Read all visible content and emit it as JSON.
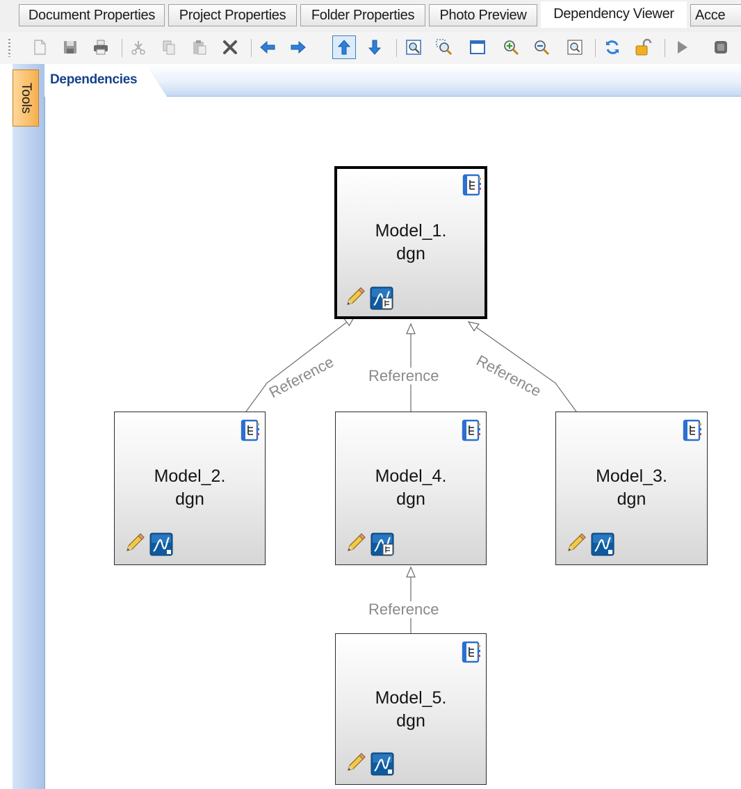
{
  "tabs": [
    {
      "label": "Document Properties"
    },
    {
      "label": "Project Properties"
    },
    {
      "label": "Folder Properties"
    },
    {
      "label": "Photo Preview"
    },
    {
      "label": "Dependency Viewer"
    },
    {
      "label": "Acce"
    }
  ],
  "active_tab": "Dependency Viewer",
  "toolbar": {
    "buttons": [
      {
        "icon": "new-document-icon"
      },
      {
        "icon": "save-icon"
      },
      {
        "icon": "print-icon"
      },
      {
        "icon": "cut-icon"
      },
      {
        "icon": "copy-icon"
      },
      {
        "icon": "paste-icon"
      },
      {
        "icon": "delete-icon"
      },
      {
        "icon": "arrow-left-icon"
      },
      {
        "icon": "arrow-right-icon"
      },
      {
        "icon": "arrow-up-icon",
        "pressed": true
      },
      {
        "icon": "arrow-down-icon"
      },
      {
        "icon": "fit-view-icon"
      },
      {
        "icon": "zoom-area-icon"
      },
      {
        "icon": "window-icon"
      },
      {
        "icon": "zoom-in-icon"
      },
      {
        "icon": "zoom-out-icon"
      },
      {
        "icon": "zoom-fit-icon"
      },
      {
        "icon": "refresh-icon"
      },
      {
        "icon": "unlock-icon"
      },
      {
        "icon": "play-icon"
      },
      {
        "icon": "stop-icon"
      }
    ]
  },
  "side_rail": {
    "tab_label": "Tools"
  },
  "document_tab": {
    "label": "Dependencies"
  },
  "colors": {
    "accent": "#15428b",
    "rail": "#a9c3e8",
    "rail_tab": "#f6b04e",
    "edge_label": "#8a8a8a"
  },
  "diagram": {
    "nodes": [
      {
        "id": "m1",
        "line1": "Model_1.",
        "line2": "dgn",
        "selected": true,
        "app_icon": "microstation-reference-icon"
      },
      {
        "id": "m2",
        "line1": "Model_2.",
        "line2": "dgn",
        "selected": false,
        "app_icon": "microstation-icon"
      },
      {
        "id": "m4",
        "line1": "Model_4.",
        "line2": "dgn",
        "selected": false,
        "app_icon": "microstation-reference-icon"
      },
      {
        "id": "m3",
        "line1": "Model_3.",
        "line2": "dgn",
        "selected": false,
        "app_icon": "microstation-icon"
      },
      {
        "id": "m5",
        "line1": "Model_5.",
        "line2": "dgn",
        "selected": false,
        "app_icon": "microstation-icon"
      }
    ],
    "edges": [
      {
        "from": "m2",
        "to": "m1",
        "label": "Reference"
      },
      {
        "from": "m4",
        "to": "m1",
        "label": "Reference"
      },
      {
        "from": "m3",
        "to": "m1",
        "label": "Reference"
      },
      {
        "from": "m5",
        "to": "m4",
        "label": "Reference"
      }
    ]
  }
}
